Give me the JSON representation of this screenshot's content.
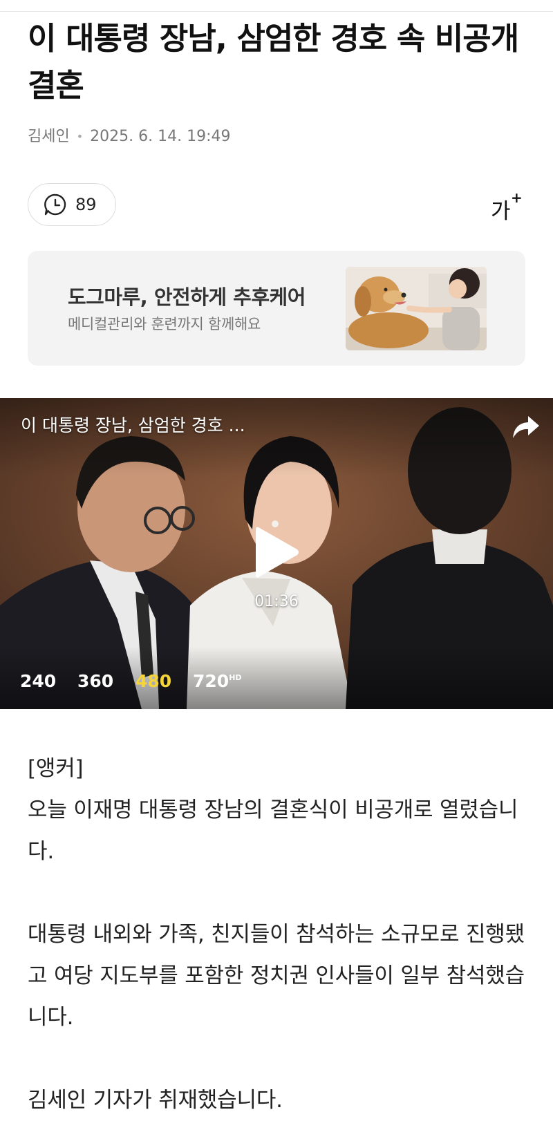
{
  "article": {
    "headline": "이 대통령 장남, 삼엄한 경호 속 비공개 결혼",
    "author": "김세인",
    "timestamp": "2025. 6. 14. 19:49"
  },
  "toolbar": {
    "comment_count": "89",
    "font_size_label": "가",
    "font_size_plus": "+"
  },
  "ad": {
    "title": "도그마루, 안전하게 추후케어",
    "subtitle": "메디컬관리와 훈련까지 함께해요"
  },
  "video": {
    "title": "이 대통령 장남, 삼엄한 경호 ...",
    "duration": "01:36",
    "qualities": [
      {
        "label": "240",
        "hd": false,
        "active": false
      },
      {
        "label": "360",
        "hd": false,
        "active": false
      },
      {
        "label": "480",
        "hd": false,
        "active": true
      },
      {
        "label": "720",
        "hd": true,
        "active": false
      }
    ],
    "hd_badge": "HD",
    "accent_color": "#f5d53a"
  },
  "body": {
    "anchor_tag": "[앵커]",
    "para1": "오늘 이재명 대통령 장남의 결혼식이 비공개로 열렸습니다.",
    "para2": "대통령 내외와 가족, 친지들이 참석하는 소규모로 진행됐고 여당 지도부를 포함한 정치권 인사들이 일부 참석했습니다.",
    "para3": "김세인 기자가 취재했습니다."
  },
  "icons": {
    "comment": "comment-icon",
    "font_size": "font-size-icon",
    "share": "share-icon",
    "play": "play-icon"
  }
}
